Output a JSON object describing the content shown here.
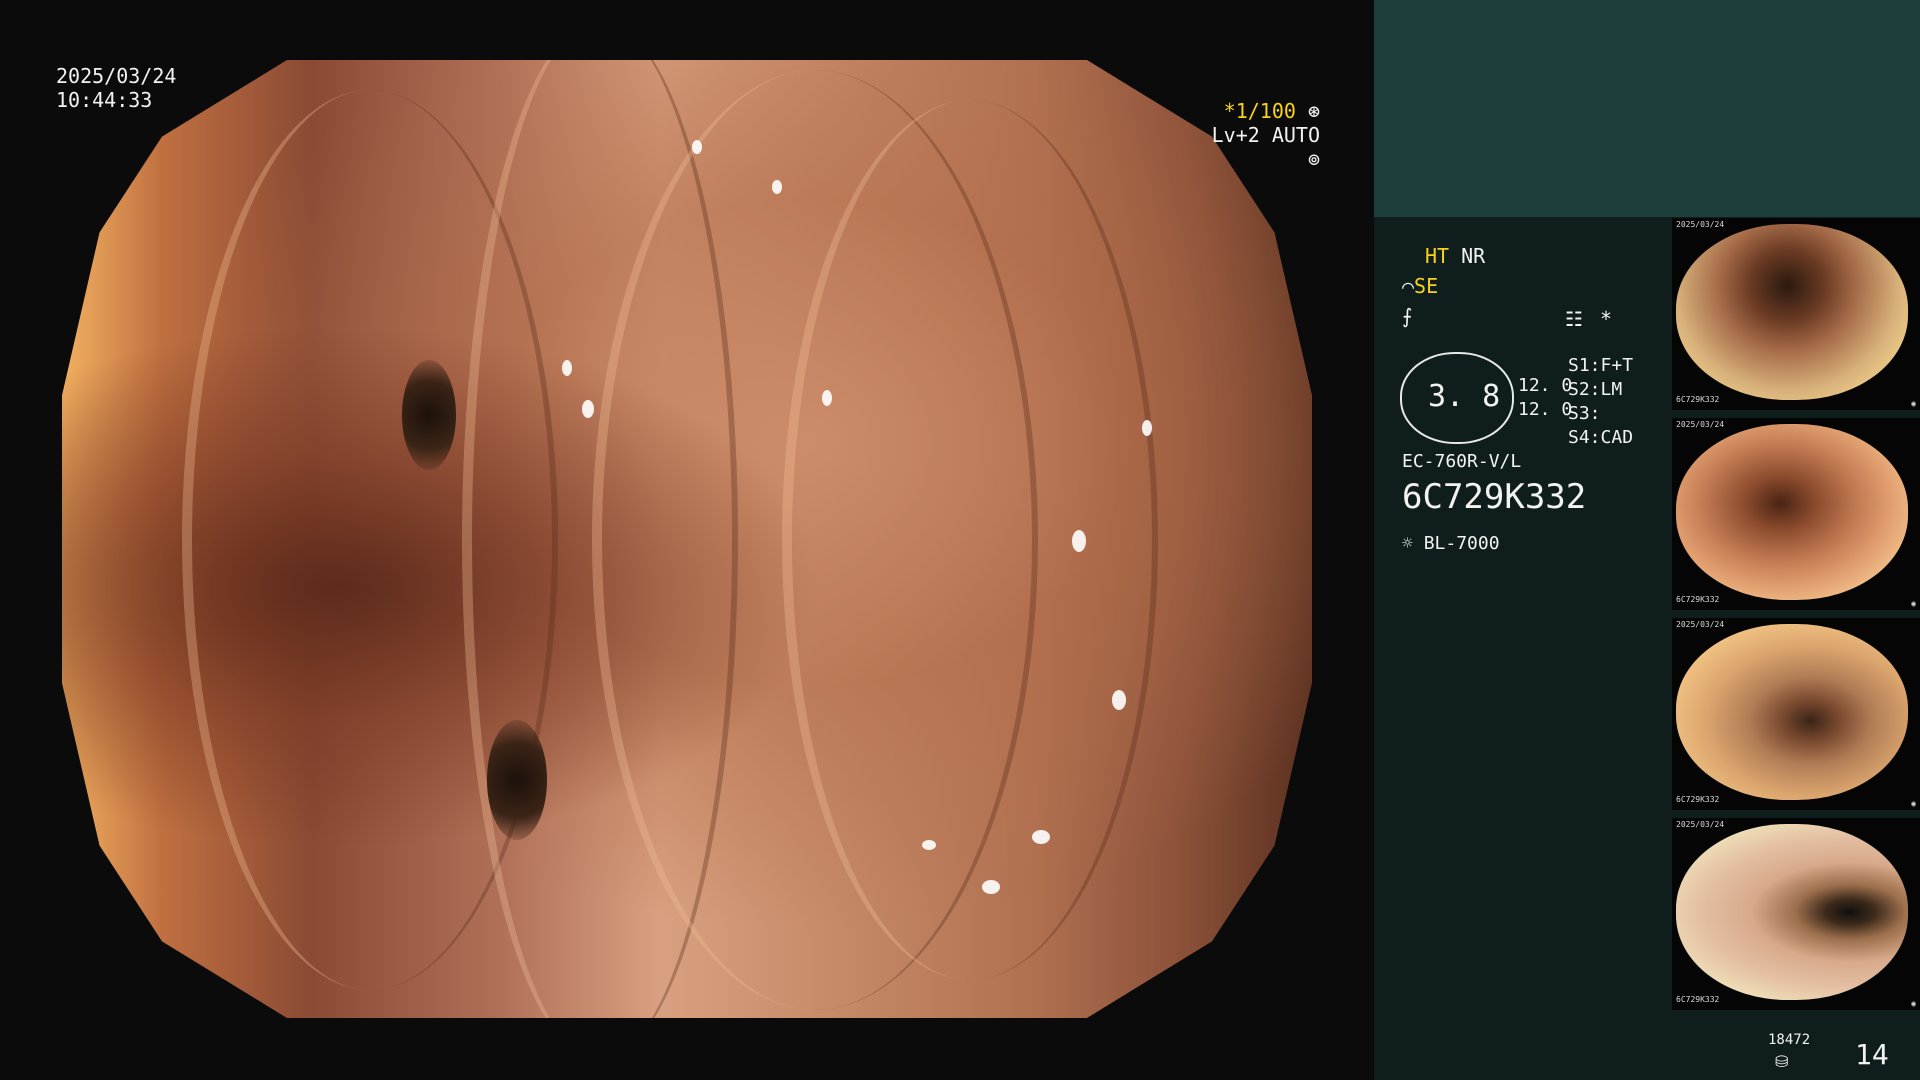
{
  "window": {
    "date": "2025/03/24",
    "time": "10:44:33"
  },
  "overlay": {
    "shutter": "*1/100",
    "level": "Lv+2 AUTO"
  },
  "panel": {
    "ht": "HT",
    "nr": "NR",
    "se": "SE",
    "asterisk": "*",
    "value_main": "3. 8",
    "val1": "12. 0",
    "val2": "12. 0",
    "s1_label": "S1:",
    "s1_value": "F+T",
    "s2_label": "S2:",
    "s2_value": "LM",
    "s3_label": "S3:",
    "s3_value": "",
    "s4_label": "S4:",
    "s4_value": "CAD",
    "scope_model": "EC-760R-V/L",
    "scope_serial": "6C729K332",
    "light_source": "BL-7000",
    "storage_count": "18472",
    "image_count": "14"
  },
  "thumbnails": [
    {
      "top_text": "2025/03/24",
      "bottom_text": "6C729K332",
      "corner_text": "◉"
    },
    {
      "top_text": "2025/03/24",
      "bottom_text": "6C729K332",
      "corner_text": "◉"
    },
    {
      "top_text": "2025/03/24",
      "bottom_text": "6C729K332",
      "corner_text": "◉"
    },
    {
      "top_text": "2025/03/24",
      "bottom_text": "6C729K332",
      "corner_text": "◉"
    }
  ]
}
